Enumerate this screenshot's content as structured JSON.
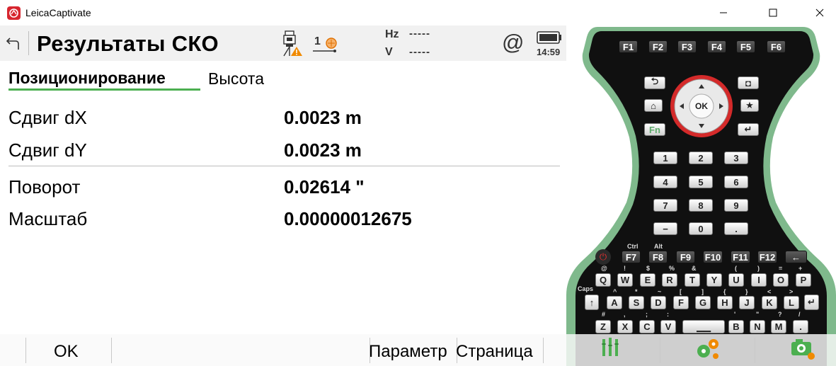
{
  "window": {
    "title": "LeicaCaptivate"
  },
  "header": {
    "title": "Результаты СКО",
    "prism_constant": "1",
    "hz_label": "Hz",
    "hz_value": "-----",
    "v_label": "V",
    "v_value": "-----",
    "connection_symbol": "@",
    "time": "14:59"
  },
  "tabs": [
    {
      "label": "Позиционирование",
      "active": true
    },
    {
      "label": "Высота",
      "active": false
    }
  ],
  "results": [
    {
      "label": "Сдвиг dX",
      "value": "0.0023 m"
    },
    {
      "label": "Сдвиг dY",
      "value": "0.0023 m"
    },
    {
      "label": "Поворот",
      "value": "0.02614 \""
    },
    {
      "label": "Масштаб",
      "value": "0.00000012675"
    }
  ],
  "function_keys": {
    "f1": "OK",
    "f4": "Параметр",
    "f5": "Страница"
  },
  "keypad": {
    "function_keys": [
      "F1",
      "F2",
      "F3",
      "F4",
      "F5",
      "F6"
    ],
    "nav": {
      "ok": "OK",
      "fn": "Fn"
    },
    "numpad": [
      "1",
      "2",
      "3",
      "4",
      "5",
      "6",
      "7",
      "8",
      "9",
      "−",
      "0",
      "."
    ],
    "fkeys2": [
      "F7",
      "F8",
      "F9",
      "F10",
      "F11",
      "F12"
    ],
    "ctrl": "Ctrl",
    "alt": "Alt",
    "caps": "Caps",
    "row_q": [
      "Q",
      "W",
      "E",
      "R",
      "T",
      "Y",
      "U",
      "I",
      "O",
      "P"
    ],
    "row_a": [
      "A",
      "S",
      "D",
      "F",
      "G",
      "H",
      "J",
      "K",
      "L"
    ],
    "row_z": [
      "Z",
      "X",
      "C",
      "V",
      "B",
      "N",
      "M"
    ],
    "sym_q": [
      "@",
      "!",
      "$",
      "%",
      "&",
      "(",
      ")",
      "=",
      "+"
    ],
    "sym_a": [
      "^",
      "*",
      "~",
      "[",
      "]",
      "{",
      "}",
      "<",
      ">"
    ],
    "sym_z": [
      "#",
      ",",
      ";",
      ":",
      "'",
      "\"",
      "?",
      "/"
    ]
  },
  "colors": {
    "accent_green": "#4caf50",
    "keypad_ring": "#7fb98c",
    "nav_red": "#d42a2a",
    "fn_green": "#5cab6a",
    "leica_red": "#d7262f"
  },
  "icons": [
    "leica-app-icon",
    "minimize-icon",
    "maximize-icon",
    "close-icon",
    "back-icon",
    "total-station-warning-icon",
    "prism-icon",
    "at-icon",
    "battery-icon",
    "survey-tools-icon",
    "settings-gears-icon",
    "camera-icon"
  ]
}
